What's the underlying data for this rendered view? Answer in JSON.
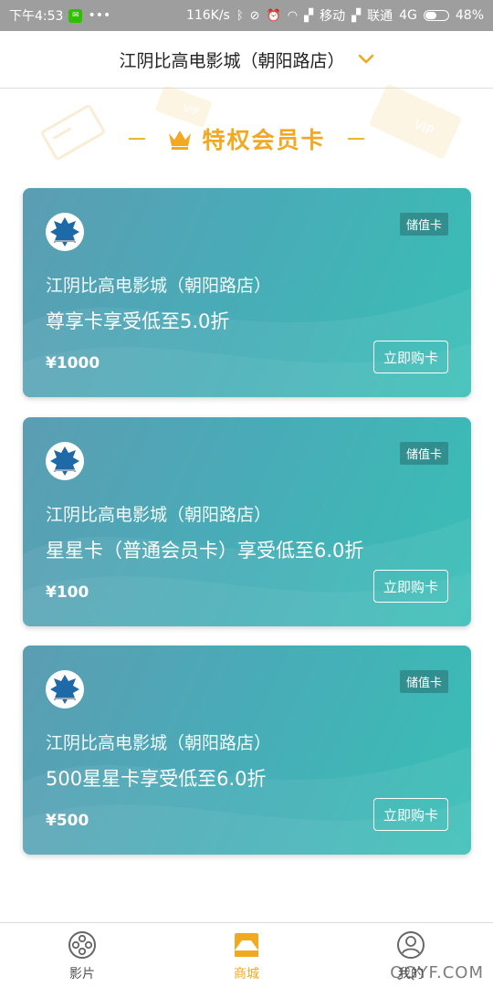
{
  "status_bar": {
    "time": "下午4:53",
    "more": "•••",
    "speed": "116K/s",
    "carrier1": "移动",
    "carrier2": "联通",
    "network": "4G",
    "battery": "48%"
  },
  "header": {
    "title": "江阴比高电影城（朝阳路店）",
    "icon": "chevron-down-icon",
    "accent": "#f2a920"
  },
  "section": {
    "title": "特权会员卡",
    "icon": "crown-icon"
  },
  "cards": [
    {
      "badge": "储值卡",
      "cinema": "江阴比高电影城（朝阳路店）",
      "desc": "尊享卡享受低至5.0折",
      "price": "¥1000",
      "button": "立即购卡"
    },
    {
      "badge": "储值卡",
      "cinema": "江阴比高电影城（朝阳路店）",
      "desc": "星星卡（普通会员卡）享受低至6.0折",
      "price": "¥100",
      "button": "立即购卡"
    },
    {
      "badge": "储值卡",
      "cinema": "江阴比高电影城（朝阳路店）",
      "desc": "500星星卡享受低至6.0折",
      "price": "¥500",
      "button": "立即购卡"
    }
  ],
  "bottom_nav": {
    "items": [
      {
        "label": "影片",
        "icon": "film-reel-icon",
        "active": false
      },
      {
        "label": "商城",
        "icon": "store-icon",
        "active": true
      },
      {
        "label": "我的",
        "icon": "user-icon",
        "active": false
      }
    ]
  },
  "watermark": "QQYF.COM",
  "colors": {
    "card_start": "#5c9db3",
    "card_end": "#38bfb6",
    "accent": "#f2a920"
  }
}
